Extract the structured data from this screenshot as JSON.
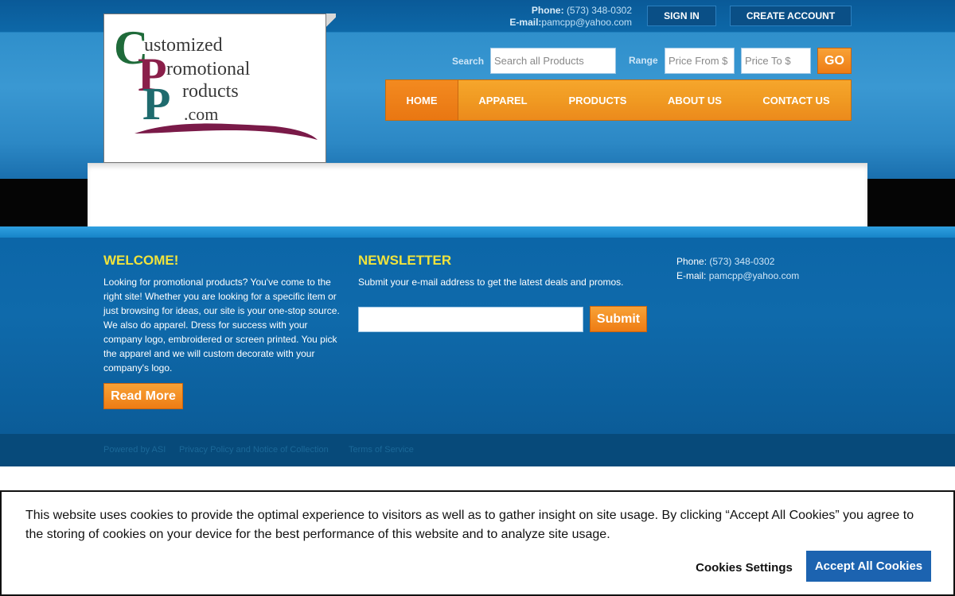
{
  "header": {
    "phone_label": "Phone:",
    "phone_value": "(573) 348-0302",
    "email_label": "E-mail:",
    "email_value": "pamcpp@yahoo.com",
    "sign_in_label": "SIGN IN",
    "create_account_label": "CREATE ACCOUNT"
  },
  "logo": {
    "line1": "ustomized",
    "line2": "romotional",
    "line3": "roducts",
    "line4": ".com",
    "initial_c": "C",
    "initial_p1": "P",
    "initial_p2": "P"
  },
  "search": {
    "label": "Search",
    "placeholder": "Search all Products",
    "range_label": "Range",
    "price_from_placeholder": "Price From $",
    "price_to_placeholder": "Price To $",
    "go_label": "GO"
  },
  "nav": {
    "items": [
      {
        "label": "HOME",
        "active": true
      },
      {
        "label": "APPAREL",
        "active": false
      },
      {
        "label": "PRODUCTS",
        "active": false
      },
      {
        "label": "ABOUT US",
        "active": false
      },
      {
        "label": "CONTACT US",
        "active": false
      }
    ]
  },
  "welcome": {
    "title": "WELCOME!",
    "text": "Looking for promotional products? You've come to the right site! Whether you are looking for a specific item or just browsing for ideas, our site is your one-stop source.  We also do apparel. Dress for success with your company logo, embroidered or screen printed. You pick the apparel and we will custom decorate with your company's logo.",
    "read_more_label": "Read More"
  },
  "newsletter": {
    "title": "NEWSLETTER",
    "text": "Submit your e-mail address to get the latest deals and promos.",
    "input_value": "",
    "submit_label": "Submit"
  },
  "footer_contact": {
    "phone_label": "Phone:",
    "phone_value": "(573) 348-0302",
    "email_label": "E-mail:",
    "email_value": "pamcpp@yahoo.com"
  },
  "legal": {
    "powered_by": "Powered by ASI",
    "privacy": "Privacy Policy and Notice of Collection",
    "terms": "Terms of Service"
  },
  "cookie": {
    "text": "This website uses cookies to provide the optimal experience to visitors as well as to gather insight on site usage. By clicking “Accept All Cookies” you agree to the storing of cookies on your device for the best performance of this website and to analyze site usage.",
    "settings_label": "Cookies Settings",
    "accept_label": "Accept All Cookies"
  },
  "colors": {
    "accent_orange": "#ee7c14",
    "header_blue": "#0f6fb0",
    "heading_yellow": "#f0e33c",
    "cookie_button_blue": "#1c63b0"
  }
}
